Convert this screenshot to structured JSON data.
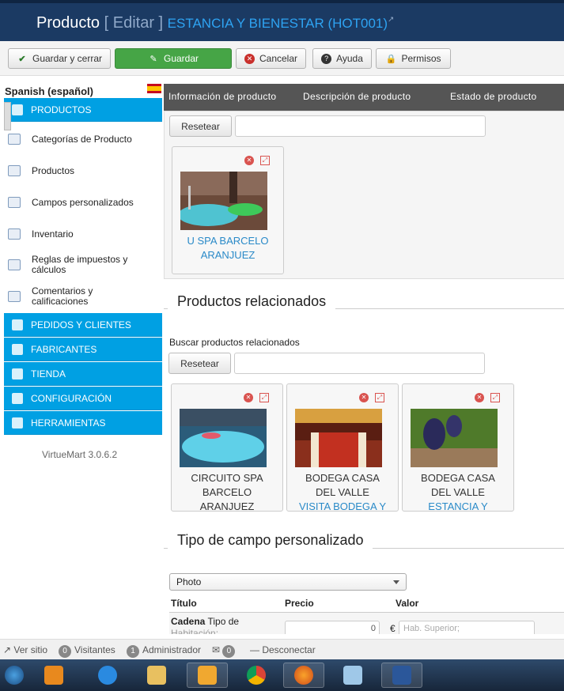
{
  "header": {
    "title": "Producto",
    "edit": "[ Editar ]",
    "product": "ESTANCIA Y BIENESTAR (HOT001)"
  },
  "toolbar": {
    "save_close": "Guardar y cerrar",
    "save": "Guardar",
    "cancel": "Cancelar",
    "help": "Ayuda",
    "permissions": "Permisos"
  },
  "sidebar": {
    "language": "Spanish (español)",
    "sections": {
      "products": "PRODUCTOS",
      "orders": "PEDIDOS Y CLIENTES",
      "manufacturers": "FABRICANTES",
      "store": "TIENDA",
      "config": "CONFIGURACIÓN",
      "tools": "HERRAMIENTAS"
    },
    "items": [
      {
        "label": "Categorías de Producto"
      },
      {
        "label": "Productos"
      },
      {
        "label": "Campos personalizados"
      },
      {
        "label": "Inventario"
      },
      {
        "label": "Reglas de impuestos y cálculos"
      },
      {
        "label": "Comentarios y calificaciones"
      }
    ],
    "version": "VirtueMart 3.0.6.2"
  },
  "tabs": {
    "info": "Información de producto",
    "desc": "Descripción de producto",
    "status": "Estado de producto"
  },
  "top_panel": {
    "reset": "Resetear",
    "card_title_1": "U SPA BARCELO",
    "card_title_2": "ARANJUEZ"
  },
  "related": {
    "legend": "Productos relacionados",
    "search_label": "Buscar productos relacionados",
    "reset": "Resetear",
    "cards": [
      {
        "l1": "CIRCUITO SPA",
        "l2": "BARCELO",
        "l3": "ARANJUEZ"
      },
      {
        "l1": "BODEGA CASA",
        "l2": "DEL VALLE",
        "l3": "VISITA BODEGA Y"
      },
      {
        "l1": "BODEGA CASA",
        "l2": "DEL VALLE",
        "l3": "ESTANCIA Y"
      }
    ]
  },
  "custom": {
    "legend": "Tipo de campo personalizado",
    "select_value": "Photo",
    "col_title": "Título",
    "col_price": "Precio",
    "col_value": "Valor",
    "row_name": "Cadena",
    "row_type": "Tipo de",
    "row_sub": "Habitación:",
    "price_value": "0",
    "currency": "€",
    "value_placeholder": "Hab. Superior;"
  },
  "status": {
    "site": "Ver sitio",
    "visitors_count": "0",
    "visitors": "Visitantes",
    "admin_count": "1",
    "admin": "Administrador",
    "msg_count": "0",
    "disconnect": "Desconectar"
  }
}
